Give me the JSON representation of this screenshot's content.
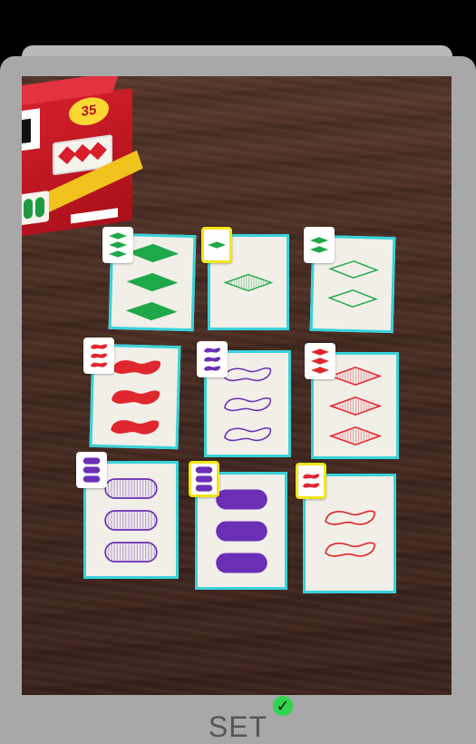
{
  "set_label": "SET",
  "valid_set_indicator": "checkmark-icon",
  "accent_color": "#38d2da",
  "selection_color": "#f2e51a",
  "cards": [
    {
      "count": 3,
      "shape": "diamond",
      "color": "green",
      "fill": "solid",
      "selected": false
    },
    {
      "count": 1,
      "shape": "diamond",
      "color": "green",
      "fill": "striped",
      "selected": true
    },
    {
      "count": 2,
      "shape": "diamond",
      "color": "green",
      "fill": "open",
      "selected": false
    },
    {
      "count": 3,
      "shape": "squiggle",
      "color": "red",
      "fill": "solid",
      "selected": false
    },
    {
      "count": 3,
      "shape": "squiggle",
      "color": "purple",
      "fill": "open",
      "selected": false
    },
    {
      "count": 3,
      "shape": "diamond",
      "color": "red",
      "fill": "striped",
      "selected": false
    },
    {
      "count": 3,
      "shape": "oval",
      "color": "purple",
      "fill": "striped",
      "selected": false
    },
    {
      "count": 3,
      "shape": "oval",
      "color": "purple",
      "fill": "solid",
      "selected": true
    },
    {
      "count": 2,
      "shape": "squiggle",
      "color": "red",
      "fill": "open",
      "selected": true
    }
  ],
  "colors": {
    "green": "#1ea84a",
    "red": "#e0262e",
    "purple": "#6b2fb6"
  }
}
